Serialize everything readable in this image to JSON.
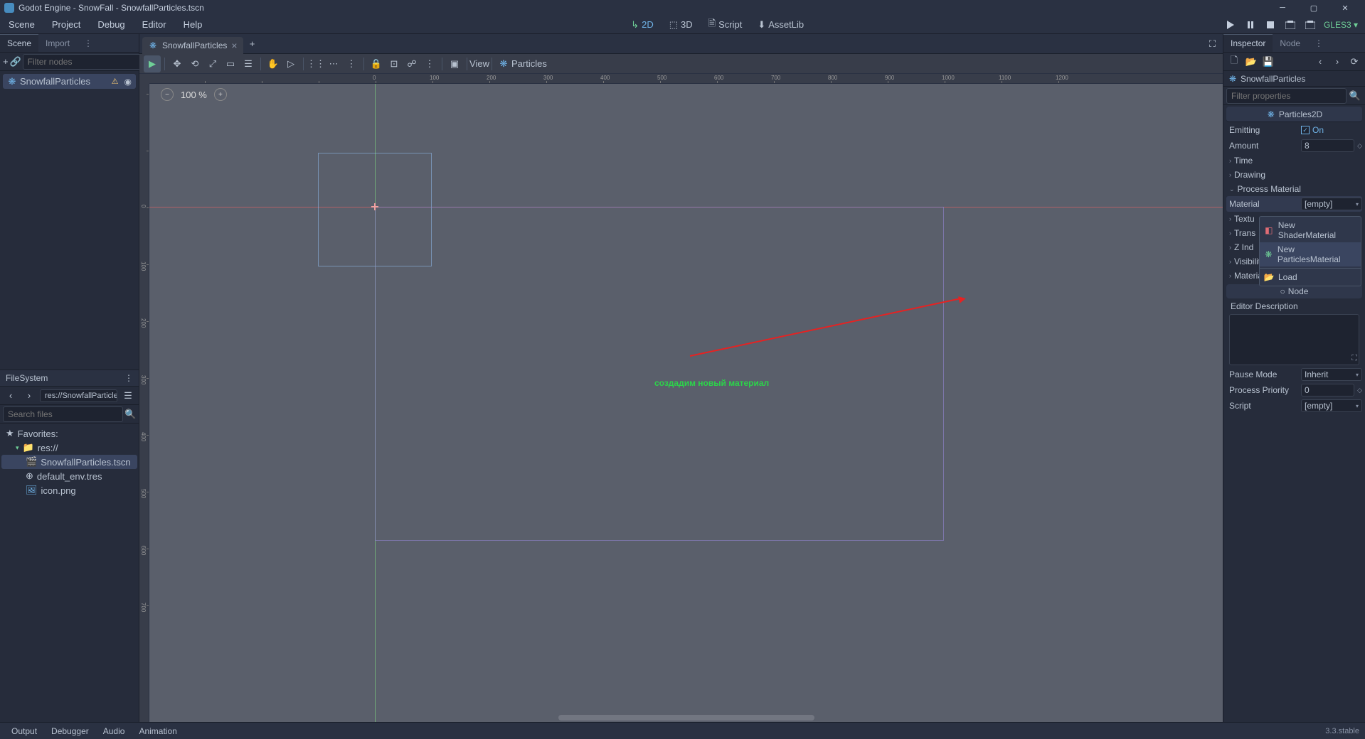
{
  "window": {
    "title": "Godot Engine - SnowFall - SnowfallParticles.tscn"
  },
  "menu": {
    "scene": "Scene",
    "project": "Project",
    "debug": "Debug",
    "editor": "Editor",
    "help": "Help"
  },
  "workspace": {
    "d2": "2D",
    "d3": "3D",
    "script": "Script",
    "assetlib": "AssetLib"
  },
  "renderer": "GLES3",
  "scene_dock": {
    "tab_scene": "Scene",
    "tab_import": "Import",
    "filter_placeholder": "Filter nodes",
    "root": "SnowfallParticles"
  },
  "filesystem": {
    "title": "FileSystem",
    "path": "res://SnowfallParticles",
    "search_placeholder": "Search files",
    "favorites": "Favorites:",
    "root": "res://",
    "items": [
      "SnowfallParticles.tscn",
      "default_env.tres",
      "icon.png"
    ]
  },
  "scene_tab": {
    "name": "SnowfallParticles"
  },
  "canvas": {
    "zoom": "100 %",
    "view_label": "View",
    "particles_label": "Particles",
    "ruler_h": [
      "0",
      "100",
      "200",
      "300",
      "400",
      "500",
      "600",
      "700",
      "800",
      "900",
      "1000",
      "1100",
      "1200"
    ],
    "ruler_v": [
      "0",
      "100",
      "200",
      "300",
      "400",
      "500",
      "600",
      "700"
    ]
  },
  "annotation": {
    "text": "создадим новый материал"
  },
  "inspector": {
    "tab_inspector": "Inspector",
    "tab_node": "Node",
    "object": "SnowfallParticles",
    "filter_placeholder": "Filter properties",
    "class": "Particles2D",
    "emitting_label": "Emitting",
    "on": "On",
    "amount_label": "Amount",
    "amount_value": "8",
    "sections": {
      "time": "Time",
      "drawing": "Drawing",
      "process_material": "Process Material",
      "textures": "Textu",
      "transform": "Trans",
      "zindex": "Z Ind",
      "visibility": "Visibility",
      "material_sec": "Material"
    },
    "material_label": "Material",
    "empty": "[empty]",
    "node_label": "Node",
    "editor_desc": "Editor Description",
    "pause_mode_label": "Pause Mode",
    "pause_mode_value": "Inherit",
    "process_priority_label": "Process Priority",
    "process_priority_value": "0",
    "script_label": "Script"
  },
  "context_menu": {
    "shader": "New ShaderMaterial",
    "particles": "New ParticlesMaterial",
    "load": "Load"
  },
  "bottom": {
    "output": "Output",
    "debugger": "Debugger",
    "audio": "Audio",
    "animation": "Animation",
    "version": "3.3.stable"
  }
}
